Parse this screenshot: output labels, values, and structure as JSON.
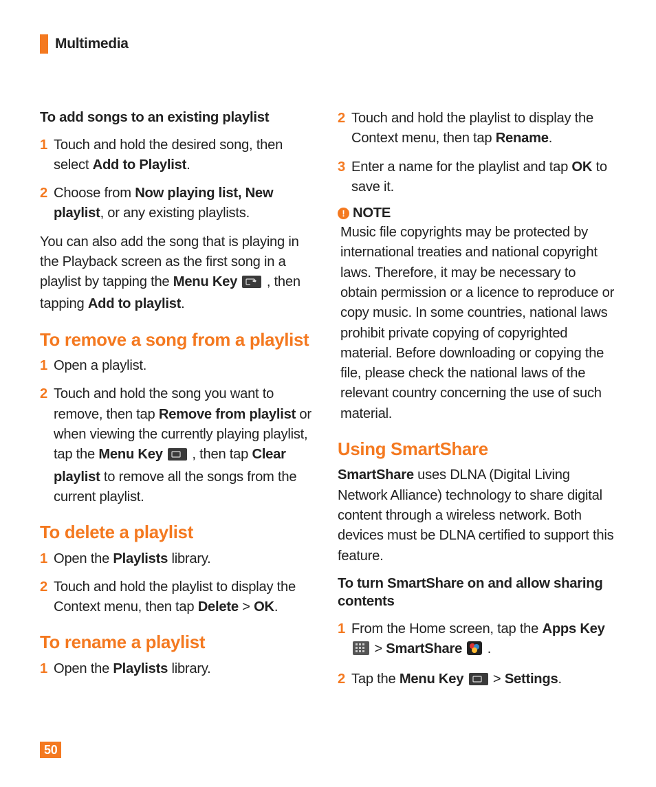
{
  "header": {
    "title": "Multimedia"
  },
  "pageNumber": "50",
  "left": {
    "addSongsTitle": "To add songs to an existing playlist",
    "addSongs": {
      "s1a": "Touch and hold the desired song, then select ",
      "s1b": "Add to Playlist",
      "s1c": ".",
      "s2a": "Choose from ",
      "s2b": "Now playing list, New playlist",
      "s2c": ", or any existing playlists."
    },
    "addNote": {
      "p1": "You can also add the song that is playing in the Playback screen as the first song in a playlist by tapping the ",
      "p2": "Menu Key",
      "p3": " , then tapping ",
      "p4": "Add to playlist",
      "p5": "."
    },
    "removeTitle": "To remove a song from a playlist",
    "remove": {
      "s1": "Open a playlist.",
      "s2a": "Touch and hold the song you want to remove, then tap ",
      "s2b": "Remove from playlist",
      "s2c": " or when viewing the currently playing playlist, tap the ",
      "s2d": "Menu Key",
      "s2e": " , then tap ",
      "s2f": "Clear playlist",
      "s2g": " to remove all the songs from the current playlist."
    },
    "deleteTitle": "To delete a playlist",
    "delete": {
      "s1a": "Open the ",
      "s1b": "Playlists",
      "s1c": " library.",
      "s2a": "Touch and hold the playlist to display the Context menu, then tap ",
      "s2b": "Delete",
      "s2c": " > ",
      "s2d": "OK",
      "s2e": "."
    },
    "renameTitle": "To rename a playlist",
    "rename": {
      "s1a": "Open the ",
      "s1b": "Playlists",
      "s1c": " library."
    }
  },
  "right": {
    "renameCont": {
      "s2a": "Touch and hold the playlist to display the Context menu, then tap ",
      "s2b": "Rename",
      "s2c": ".",
      "s3a": "Enter a name for the playlist and tap ",
      "s3b": "OK",
      "s3c": " to save it."
    },
    "noteLabel": "NOTE",
    "noteBody": "Music file copyrights may be protected by international treaties and national copyright laws. Therefore, it may be necessary to obtain permission or a licence to reproduce or copy music. In some countries, national laws prohibit private copying of copyrighted material. Before downloading or copying the file, please check the national laws of the relevant country concerning the use of such material.",
    "smartTitle": "Using SmartShare",
    "smartIntro": {
      "a": "SmartShare",
      "b": " uses DLNA (Digital Living Network Alliance) technology to share digital content through a wireless network. Both devices must be DLNA certified to support this feature."
    },
    "turnOnTitle": "To turn SmartShare on and allow sharing contents",
    "turnOn": {
      "s1a": "From the Home screen, tap the ",
      "s1b": "Apps Key",
      "s1c": " > ",
      "s1d": "SmartShare",
      "s1e": " .",
      "s2a": "Tap the ",
      "s2b": "Menu Key",
      "s2c": "  > ",
      "s2d": "Settings",
      "s2e": "."
    }
  },
  "nums": {
    "n1": "1",
    "n2": "2",
    "n3": "3"
  }
}
